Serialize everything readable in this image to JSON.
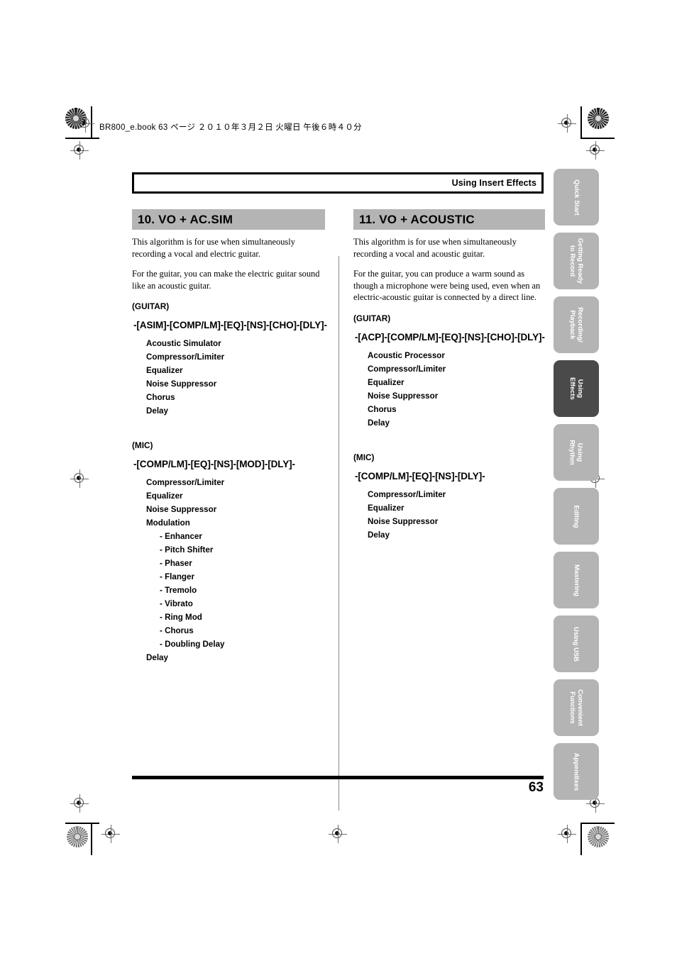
{
  "slug": "BR800_e.book 63 ページ ２０１０年３月２日 火曜日 午後６時４０分",
  "running_head": "Using Insert Effects",
  "page_number": "63",
  "colors": {
    "section_bar": "#b4b4b4",
    "tab_inactive": "#b4b4b4",
    "tab_active": "#4a4a4a",
    "rule": "#000000",
    "divider": "#8a8a8a"
  },
  "columns": {
    "left": {
      "section_title": "10. VO + AC.SIM",
      "paragraphs": [
        "This algorithm is for use when simultaneously recording a vocal and electric guitar.",
        "For the guitar, you can make the electric guitar sound like an acoustic guitar."
      ],
      "groups": [
        {
          "label": "(GUITAR)",
          "chain": "-[ASIM]-[COMP/LM]-[EQ]-[NS]-[CHO]-[DLY]-",
          "effects": [
            {
              "name": "Acoustic Simulator",
              "sub": false
            },
            {
              "name": "Compressor/Limiter",
              "sub": false
            },
            {
              "name": "Equalizer",
              "sub": false
            },
            {
              "name": "Noise Suppressor",
              "sub": false
            },
            {
              "name": "Chorus",
              "sub": false
            },
            {
              "name": "Delay",
              "sub": false
            }
          ]
        },
        {
          "label": "(MIC)",
          "chain": "-[COMP/LM]-[EQ]-[NS]-[MOD]-[DLY]-",
          "effects": [
            {
              "name": "Compressor/Limiter",
              "sub": false
            },
            {
              "name": "Equalizer",
              "sub": false
            },
            {
              "name": "Noise Suppressor",
              "sub": false
            },
            {
              "name": "Modulation",
              "sub": false
            },
            {
              "name": "- Enhancer",
              "sub": true
            },
            {
              "name": "- Pitch Shifter",
              "sub": true
            },
            {
              "name": "- Phaser",
              "sub": true
            },
            {
              "name": "- Flanger",
              "sub": true
            },
            {
              "name": "- Tremolo",
              "sub": true
            },
            {
              "name": "- Vibrato",
              "sub": true
            },
            {
              "name": "- Ring Mod",
              "sub": true
            },
            {
              "name": "- Chorus",
              "sub": true
            },
            {
              "name": "- Doubling Delay",
              "sub": true
            },
            {
              "name": "Delay",
              "sub": false
            }
          ]
        }
      ]
    },
    "right": {
      "section_title": "11. VO + ACOUSTIC",
      "paragraphs": [
        "This algorithm is for use when simultaneously recording a vocal and acoustic guitar.",
        "For the guitar, you can produce a warm sound as though a microphone were being used, even when an electric-acoustic guitar is connected by a direct line."
      ],
      "groups": [
        {
          "label": "(GUITAR)",
          "chain": "-[ACP]-[COMP/LM]-[EQ]-[NS]-[CHO]-[DLY]-",
          "effects": [
            {
              "name": "Acoustic Processor",
              "sub": false
            },
            {
              "name": "Compressor/Limiter",
              "sub": false
            },
            {
              "name": "Equalizer",
              "sub": false
            },
            {
              "name": "Noise Suppressor",
              "sub": false
            },
            {
              "name": "Chorus",
              "sub": false
            },
            {
              "name": "Delay",
              "sub": false
            }
          ]
        },
        {
          "label": "(MIC)",
          "chain": "-[COMP/LM]-[EQ]-[NS]-[DLY]-",
          "effects": [
            {
              "name": "Compressor/Limiter",
              "sub": false
            },
            {
              "name": "Equalizer",
              "sub": false
            },
            {
              "name": "Noise Suppressor",
              "sub": false
            },
            {
              "name": "Delay",
              "sub": false
            }
          ]
        }
      ]
    }
  },
  "tabs": [
    {
      "label": "Quick Start",
      "active": false
    },
    {
      "label": "Getting Ready\nto Record",
      "active": false
    },
    {
      "label": "Recording/\nPlayback",
      "active": false
    },
    {
      "label": "Using\nEffects",
      "active": true
    },
    {
      "label": "Using\nRhythm",
      "active": false
    },
    {
      "label": "Editing",
      "active": false
    },
    {
      "label": "Mastering",
      "active": false
    },
    {
      "label": "Using USB",
      "active": false
    },
    {
      "label": "Convenient\nFunctions",
      "active": false
    },
    {
      "label": "Appendixes",
      "active": false
    }
  ]
}
